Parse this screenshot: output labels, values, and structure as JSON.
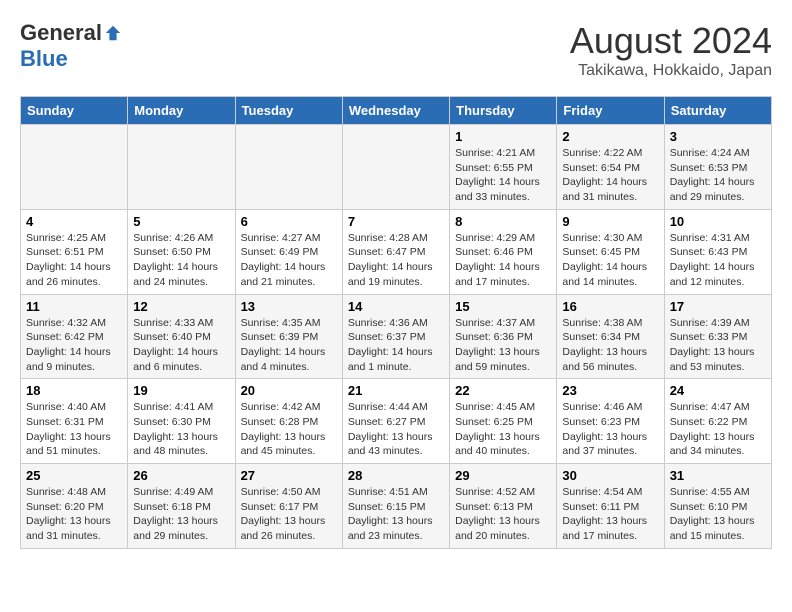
{
  "logo": {
    "general": "General",
    "blue": "Blue"
  },
  "header": {
    "title": "August 2024",
    "subtitle": "Takikawa, Hokkaido, Japan"
  },
  "weekdays": [
    "Sunday",
    "Monday",
    "Tuesday",
    "Wednesday",
    "Thursday",
    "Friday",
    "Saturday"
  ],
  "weeks": [
    [
      {
        "day": "",
        "info": ""
      },
      {
        "day": "",
        "info": ""
      },
      {
        "day": "",
        "info": ""
      },
      {
        "day": "",
        "info": ""
      },
      {
        "day": "1",
        "info": "Sunrise: 4:21 AM\nSunset: 6:55 PM\nDaylight: 14 hours\nand 33 minutes."
      },
      {
        "day": "2",
        "info": "Sunrise: 4:22 AM\nSunset: 6:54 PM\nDaylight: 14 hours\nand 31 minutes."
      },
      {
        "day": "3",
        "info": "Sunrise: 4:24 AM\nSunset: 6:53 PM\nDaylight: 14 hours\nand 29 minutes."
      }
    ],
    [
      {
        "day": "4",
        "info": "Sunrise: 4:25 AM\nSunset: 6:51 PM\nDaylight: 14 hours\nand 26 minutes."
      },
      {
        "day": "5",
        "info": "Sunrise: 4:26 AM\nSunset: 6:50 PM\nDaylight: 14 hours\nand 24 minutes."
      },
      {
        "day": "6",
        "info": "Sunrise: 4:27 AM\nSunset: 6:49 PM\nDaylight: 14 hours\nand 21 minutes."
      },
      {
        "day": "7",
        "info": "Sunrise: 4:28 AM\nSunset: 6:47 PM\nDaylight: 14 hours\nand 19 minutes."
      },
      {
        "day": "8",
        "info": "Sunrise: 4:29 AM\nSunset: 6:46 PM\nDaylight: 14 hours\nand 17 minutes."
      },
      {
        "day": "9",
        "info": "Sunrise: 4:30 AM\nSunset: 6:45 PM\nDaylight: 14 hours\nand 14 minutes."
      },
      {
        "day": "10",
        "info": "Sunrise: 4:31 AM\nSunset: 6:43 PM\nDaylight: 14 hours\nand 12 minutes."
      }
    ],
    [
      {
        "day": "11",
        "info": "Sunrise: 4:32 AM\nSunset: 6:42 PM\nDaylight: 14 hours\nand 9 minutes."
      },
      {
        "day": "12",
        "info": "Sunrise: 4:33 AM\nSunset: 6:40 PM\nDaylight: 14 hours\nand 6 minutes."
      },
      {
        "day": "13",
        "info": "Sunrise: 4:35 AM\nSunset: 6:39 PM\nDaylight: 14 hours\nand 4 minutes."
      },
      {
        "day": "14",
        "info": "Sunrise: 4:36 AM\nSunset: 6:37 PM\nDaylight: 14 hours\nand 1 minute."
      },
      {
        "day": "15",
        "info": "Sunrise: 4:37 AM\nSunset: 6:36 PM\nDaylight: 13 hours\nand 59 minutes."
      },
      {
        "day": "16",
        "info": "Sunrise: 4:38 AM\nSunset: 6:34 PM\nDaylight: 13 hours\nand 56 minutes."
      },
      {
        "day": "17",
        "info": "Sunrise: 4:39 AM\nSunset: 6:33 PM\nDaylight: 13 hours\nand 53 minutes."
      }
    ],
    [
      {
        "day": "18",
        "info": "Sunrise: 4:40 AM\nSunset: 6:31 PM\nDaylight: 13 hours\nand 51 minutes."
      },
      {
        "day": "19",
        "info": "Sunrise: 4:41 AM\nSunset: 6:30 PM\nDaylight: 13 hours\nand 48 minutes."
      },
      {
        "day": "20",
        "info": "Sunrise: 4:42 AM\nSunset: 6:28 PM\nDaylight: 13 hours\nand 45 minutes."
      },
      {
        "day": "21",
        "info": "Sunrise: 4:44 AM\nSunset: 6:27 PM\nDaylight: 13 hours\nand 43 minutes."
      },
      {
        "day": "22",
        "info": "Sunrise: 4:45 AM\nSunset: 6:25 PM\nDaylight: 13 hours\nand 40 minutes."
      },
      {
        "day": "23",
        "info": "Sunrise: 4:46 AM\nSunset: 6:23 PM\nDaylight: 13 hours\nand 37 minutes."
      },
      {
        "day": "24",
        "info": "Sunrise: 4:47 AM\nSunset: 6:22 PM\nDaylight: 13 hours\nand 34 minutes."
      }
    ],
    [
      {
        "day": "25",
        "info": "Sunrise: 4:48 AM\nSunset: 6:20 PM\nDaylight: 13 hours\nand 31 minutes."
      },
      {
        "day": "26",
        "info": "Sunrise: 4:49 AM\nSunset: 6:18 PM\nDaylight: 13 hours\nand 29 minutes."
      },
      {
        "day": "27",
        "info": "Sunrise: 4:50 AM\nSunset: 6:17 PM\nDaylight: 13 hours\nand 26 minutes."
      },
      {
        "day": "28",
        "info": "Sunrise: 4:51 AM\nSunset: 6:15 PM\nDaylight: 13 hours\nand 23 minutes."
      },
      {
        "day": "29",
        "info": "Sunrise: 4:52 AM\nSunset: 6:13 PM\nDaylight: 13 hours\nand 20 minutes."
      },
      {
        "day": "30",
        "info": "Sunrise: 4:54 AM\nSunset: 6:11 PM\nDaylight: 13 hours\nand 17 minutes."
      },
      {
        "day": "31",
        "info": "Sunrise: 4:55 AM\nSunset: 6:10 PM\nDaylight: 13 hours\nand 15 minutes."
      }
    ]
  ]
}
